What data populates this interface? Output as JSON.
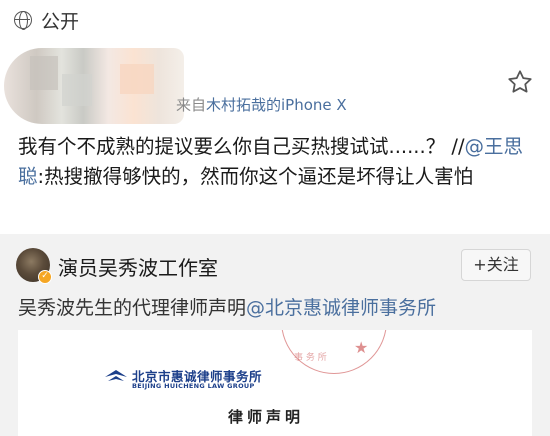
{
  "visibility": {
    "icon": "globe-icon",
    "label": "公开"
  },
  "post": {
    "source_prefix": "来自",
    "source_name": "木村拓哉的iPhone X",
    "text_main": "我有个不成熟的提议要么你自己买热搜试试......？ //",
    "mention_prefix": "@",
    "mention_name": "王思聪",
    "text_rest": ":热搜撤得够快的，然而你这个逼还是坏得让人害怕",
    "favorite_icon": "star-outline-icon"
  },
  "repost": {
    "author_name": "演员吴秀波工作室",
    "follow_label": "+关注",
    "text_main": "吴秀波先生的代理律师声明",
    "text_mention": "@北京惠诚律师事务所",
    "document": {
      "firm_name_cn": "北京市惠诚律师事务所",
      "firm_name_en": "BEIJING HUICHENG LAW GROUP",
      "heading": "律师声明"
    }
  },
  "colors": {
    "link": "#4a6f9e",
    "firm_blue": "#1c3f8a",
    "card_bg": "#f2f2f2",
    "seal_red": "#d67474"
  }
}
